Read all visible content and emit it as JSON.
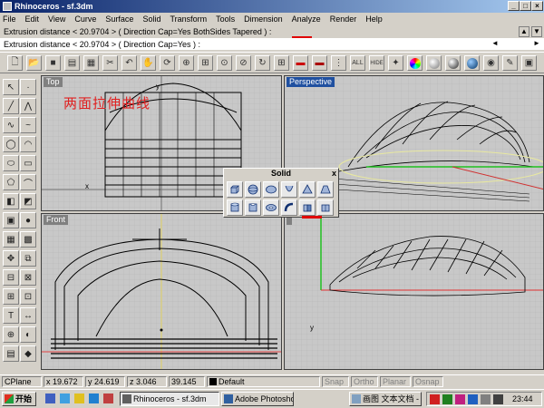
{
  "window": {
    "title": "Rhinoceros - sf.3dm"
  },
  "menu": [
    "File",
    "Edit",
    "View",
    "Curve",
    "Surface",
    "Solid",
    "Transform",
    "Tools",
    "Dimension",
    "Analyze",
    "Render",
    "Help"
  ],
  "command": {
    "history": "Extrusion distance < 20.9704 > ( Direction Cap=Yes BothSides Tapered ) :",
    "prompt": "Extrusion distance < 20.9704 > ( Direction Cap=Yes ) :"
  },
  "toolbar_icons": [
    "new-file-icon",
    "open-file-icon",
    "save-icon",
    "print-icon",
    "import-icon",
    "cut-icon",
    "undo-icon",
    "pan-hand-icon",
    "rotate-view-icon",
    "zoom-icon",
    "zoom-window-icon",
    "zoom-extents-icon",
    "zoom-selected-icon",
    "redraw-icon",
    "grid-icon",
    "car-render-icon",
    "car-render2-icon",
    "layer-icon",
    "point-icon",
    "hide-icon",
    "light-icon",
    "color-wheel-icon",
    "shade-sphere-icon",
    "render-sphere-icon",
    "material-icon",
    "camera-icon",
    "note-icon",
    "properties-icon"
  ],
  "toolbar_labels": {
    "hide": "HIDE",
    "point": "ALL"
  },
  "viewports": {
    "top": {
      "title": "Top",
      "annotation": "两面拉伸曲线"
    },
    "perspective": {
      "title": "Perspective"
    },
    "front": {
      "title": "Front"
    },
    "right": {
      "title": ""
    }
  },
  "solid_panel": {
    "title": "Solid",
    "close": "x"
  },
  "status": {
    "cplane": "CPlane",
    "x": "x 19.672",
    "y": "y 24.619",
    "z": "z 3.046",
    "value": "39.145",
    "layer": "Default",
    "snap": "Snap",
    "ortho": "Ortho",
    "planar": "Planar",
    "osnap": "Osnap"
  },
  "taskbar": {
    "start": "开始",
    "tasks": [
      "Rhinoceros - sf.3dm",
      "Adobe Photosho...",
      "画图 文本文档 - 记事本"
    ],
    "clock": "23:44"
  },
  "colors": {
    "titlebar": "#0a246a",
    "accent_red": "#e00000",
    "viewport_bg": "#c8c8c8"
  }
}
